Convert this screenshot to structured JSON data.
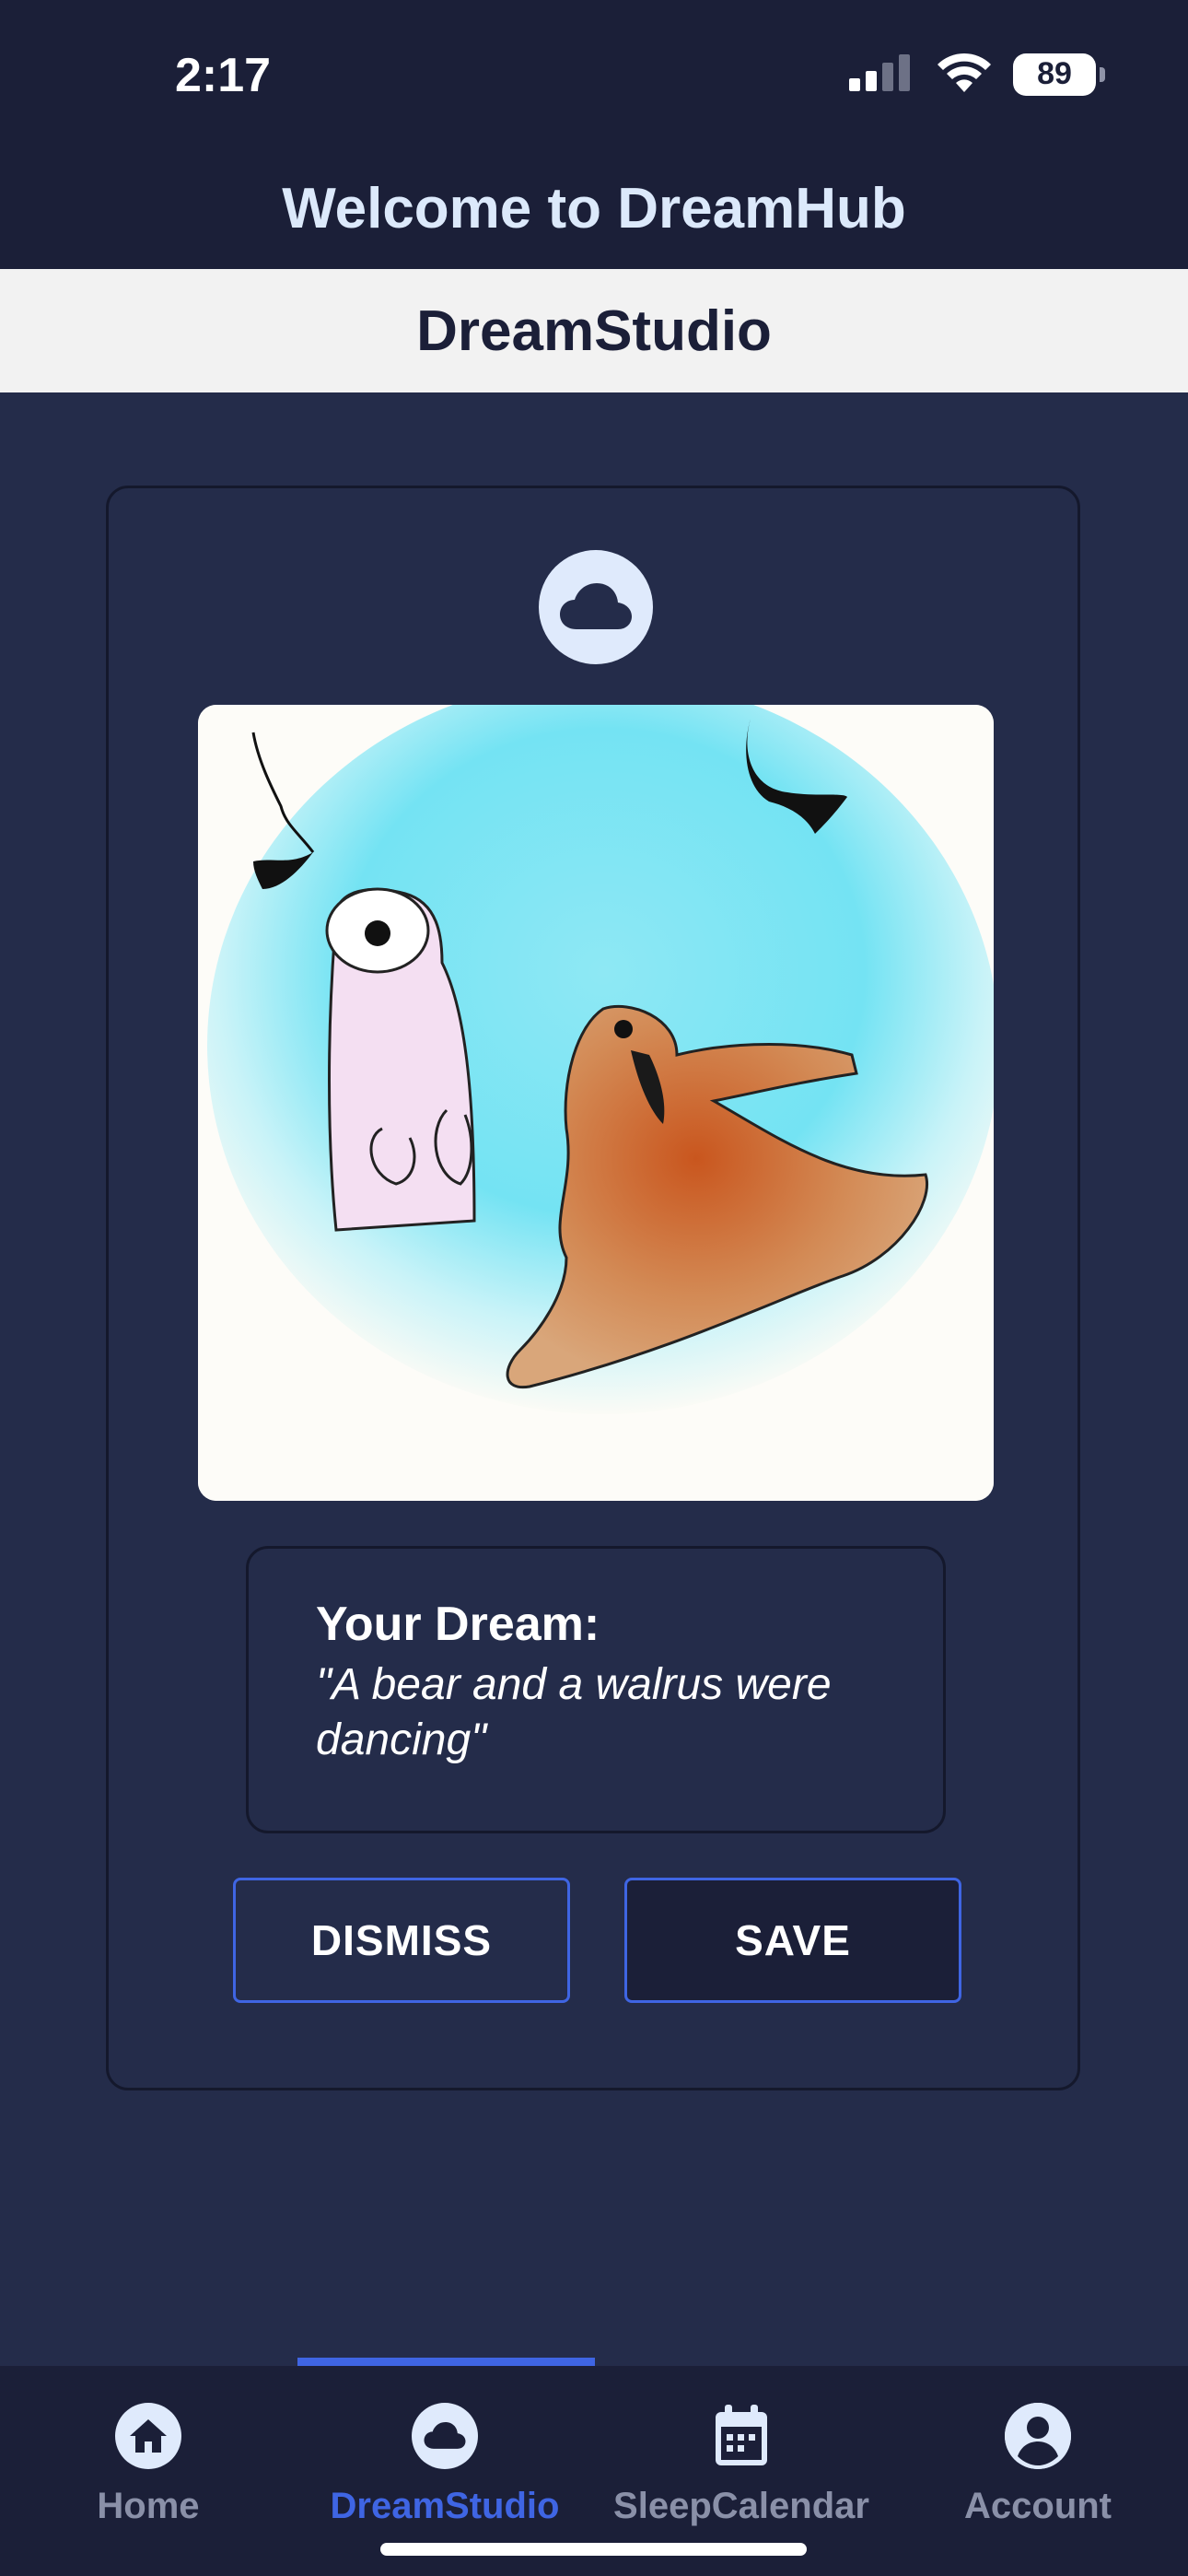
{
  "status_bar": {
    "time": "2:17",
    "battery": "89",
    "icons": [
      "signal-icon",
      "wifi-icon",
      "battery-icon"
    ]
  },
  "header": {
    "title": "Welcome to DreamHub"
  },
  "section": {
    "title": "DreamStudio"
  },
  "card": {
    "badge_icon": "cloud-icon",
    "image_description_icon": "dream-image",
    "dream_label": "Your Dream:",
    "dream_text": "\"A bear and a walrus were dancing\"",
    "dismiss_label": "DISMISS",
    "save_label": "SAVE"
  },
  "tabs": [
    {
      "label": "Home",
      "icon": "home-icon",
      "active": false
    },
    {
      "label": "DreamStudio",
      "icon": "cloud-icon",
      "active": true
    },
    {
      "label": "SleepCalendar",
      "icon": "calendar-icon",
      "active": false
    },
    {
      "label": "Account",
      "icon": "account-icon",
      "active": false
    }
  ],
  "colors": {
    "accent": "#3f65e3",
    "background": "#242c4a",
    "header": "#1b1f38",
    "section_bar": "#f2f2f2"
  }
}
